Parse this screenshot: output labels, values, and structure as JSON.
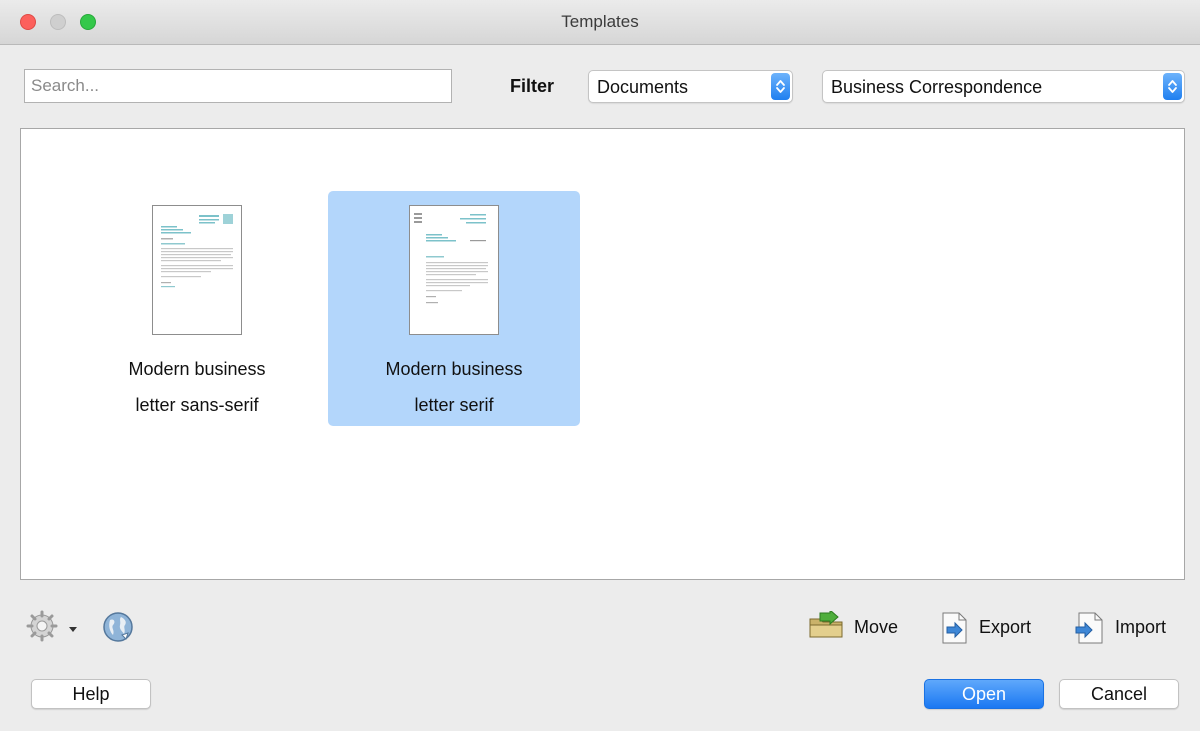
{
  "window": {
    "title": "Templates"
  },
  "search": {
    "placeholder": "Search...",
    "value": ""
  },
  "filter": {
    "label": "Filter",
    "type_selected": "Documents",
    "category_selected": "Business Correspondence"
  },
  "templates": [
    {
      "line1": "Modern business",
      "line2": "letter sans-serif",
      "selected": false
    },
    {
      "line1": "Modern business",
      "line2": "letter serif",
      "selected": true
    }
  ],
  "toolbar": {
    "settings_icon": "gear-icon",
    "online_icon": "globe-icon",
    "move_label": "Move",
    "export_label": "Export",
    "import_label": "Import"
  },
  "buttons": {
    "help": "Help",
    "open": "Open",
    "cancel": "Cancel"
  },
  "colors": {
    "accent": "#1a78f2",
    "selection": "#b3d6fb",
    "close": "#fc605c",
    "zoom": "#34c84a"
  }
}
